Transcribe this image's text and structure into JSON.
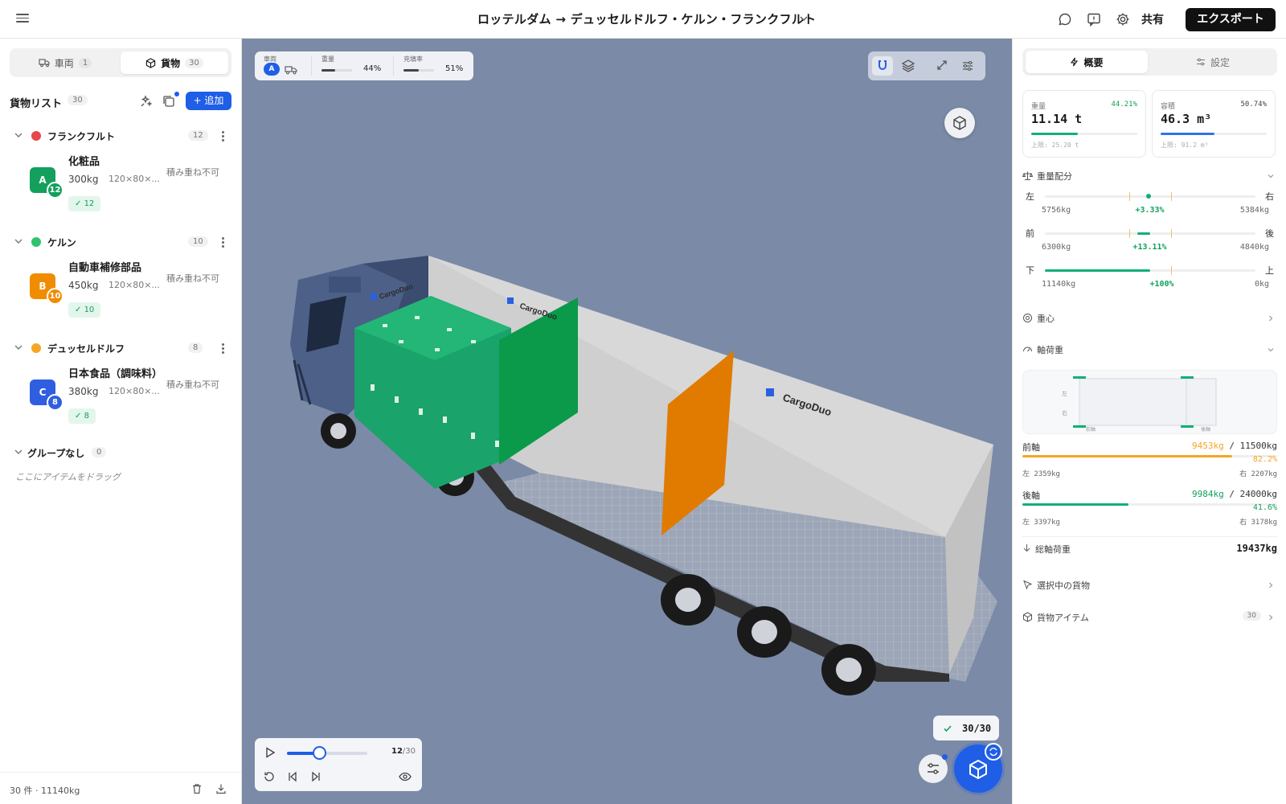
{
  "header": {
    "route_title": "ロッテルダム → デュッセルドルフ・ケルン・フランクフルト",
    "share_label": "共有",
    "export_label": "エクスポート"
  },
  "left": {
    "tabs": [
      {
        "label": "車両",
        "count": "1"
      },
      {
        "label": "貨物",
        "count": "30"
      }
    ],
    "list_title": "貨物リスト",
    "list_count": "30",
    "add_label": "+ 追加",
    "groups": [
      {
        "name": "フランクフルト",
        "count": "12",
        "color": "#e5484d",
        "item": {
          "name": "化粧品",
          "weight": "300kg",
          "dim": "120×80×...",
          "stack": "積み重ね不可",
          "letter": "A",
          "badge": "12",
          "badge_color": "#12a05c",
          "check": "12"
        }
      },
      {
        "name": "ケルン",
        "count": "10",
        "color": "#30c36b",
        "item": {
          "name": "自動車補修部品",
          "weight": "450kg",
          "dim": "120×80×...",
          "stack": "積み重ね不可",
          "letter": "B",
          "badge": "10",
          "badge_color": "#f08c00",
          "check": "10"
        }
      },
      {
        "name": "デュッセルドルフ",
        "count": "8",
        "color": "#f5a623",
        "item": {
          "name": "日本食品（調味料）",
          "weight": "380kg",
          "dim": "120×80×...",
          "stack": "積み重ね不可",
          "letter": "C",
          "badge": "8",
          "badge_color": "#2f5fe0",
          "check": "8"
        }
      },
      {
        "name": "グループなし",
        "count": "0"
      }
    ],
    "drop_hint": "ここにアイテムをドラッグ",
    "footer": "30 件 · 11140kg"
  },
  "viewport": {
    "vehicle_label": "車両",
    "vehicle_badge": "A",
    "weight_label": "重量",
    "weight_pct": "44%",
    "weight_fraction": 0.44,
    "fill_label": "充填率",
    "fill_pct": "51%",
    "fill_fraction": 0.51,
    "brand": "CargoDuo",
    "progress_count": "12",
    "progress_total": "/30",
    "progress_fraction": 0.4,
    "done_label": "30/30"
  },
  "right": {
    "tabs": [
      "概要",
      "設定"
    ],
    "weight_card": {
      "label": "重量",
      "pct": "44.21%",
      "value": "11.14 t",
      "limit": "上限: 25.20 t",
      "fraction": 0.4421,
      "color": "#12b076"
    },
    "volume_card": {
      "label": "容積",
      "pct": "50.74%",
      "value": "46.3 m³",
      "limit": "上限: 91.2 m³",
      "fraction": 0.5074,
      "color": "#2f74e8"
    },
    "balance_title": "重量配分",
    "balance": [
      {
        "left": "左",
        "right": "右",
        "left_val": "5756kg",
        "pct": "+3.33%",
        "right_val": "5384kg"
      },
      {
        "left": "前",
        "right": "後",
        "left_val": "6300kg",
        "pct": "+13.11%",
        "right_val": "4840kg"
      },
      {
        "left": "下",
        "right": "上",
        "left_val": "11140kg",
        "pct": "+100%",
        "right_val": "0kg"
      }
    ],
    "cog_title": "重心",
    "axle_title": "軸荷重",
    "diagram": {
      "left": "左",
      "right": "右",
      "front": "前軸",
      "rear": "後軸"
    },
    "front_axle": {
      "name": "前軸",
      "load": "9453kg",
      "limit": "/ 11500kg",
      "pct": "82.2%",
      "fraction": 0.822,
      "left": "左 2359kg",
      "right": "右 2207kg",
      "color": "#f5a623"
    },
    "rear_axle": {
      "name": "後軸",
      "load": "9984kg",
      "limit": "/ 24000kg",
      "pct": "41.6%",
      "fraction": 0.416,
      "left": "左 3397kg",
      "right": "右 3178kg",
      "color": "#12b076"
    },
    "total_label": "総軸荷重",
    "total_value": "19437kg",
    "selected_title": "選択中の貨物",
    "items_title": "貨物アイテム",
    "items_count": "30"
  }
}
